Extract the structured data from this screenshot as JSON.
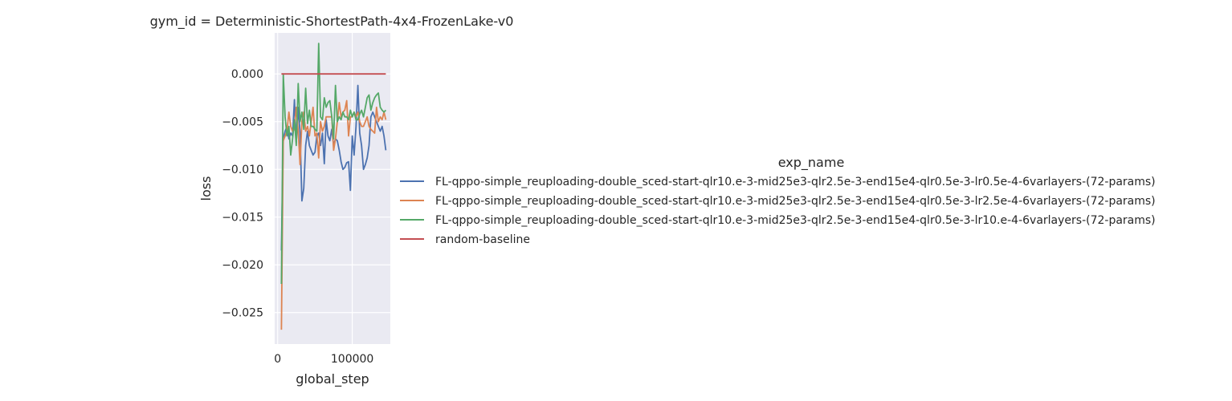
{
  "chart_data": {
    "type": "line",
    "title": "gym_id = Deterministic-ShortestPath-4x4-FrozenLake-v0",
    "xlabel": "global_step",
    "ylabel": "loss",
    "xlim": [
      -4000,
      151000
    ],
    "ylim": [
      -0.0283,
      0.0043
    ],
    "xticks": [
      0,
      100000
    ],
    "xtick_labels": [
      "0",
      "100000"
    ],
    "yticks": [
      0.0,
      -0.005,
      -0.01,
      -0.015,
      -0.02,
      -0.025
    ],
    "ytick_labels": [
      "0.000",
      "−0.005",
      "−0.010",
      "−0.015",
      "−0.020",
      "−0.025"
    ],
    "grid": true,
    "legend_position": "right",
    "legend_title": "exp_name",
    "series": [
      {
        "name": "FL-qppo-simple_reuploading-double_sced-start-qlr10.e-3-mid25e3-qlr2.5e-3-end15e4-qlr0.5e-3-lr0.5e-4-6varlayers-(72-params)",
        "color": "#4c72b0",
        "x": [
          5000,
          7500,
          10000,
          12500,
          15000,
          17500,
          20000,
          22500,
          25000,
          27500,
          30000,
          32500,
          35000,
          37500,
          40000,
          42500,
          45000,
          47500,
          50000,
          52500,
          55000,
          57500,
          60000,
          62500,
          65000,
          67500,
          70000,
          72500,
          75000,
          77500,
          80000,
          82500,
          85000,
          87500,
          90000,
          92500,
          95000,
          97500,
          100000,
          102500,
          105000,
          107500,
          110000,
          112500,
          115000,
          117500,
          120000,
          122500,
          125000,
          127500,
          130000,
          132500,
          135000,
          137500,
          140000,
          142500,
          145000
        ],
        "y": [
          -0.0185,
          -0.0068,
          -0.006,
          -0.0055,
          -0.0068,
          -0.0062,
          -0.0065,
          -0.0027,
          -0.0072,
          -0.0035,
          -0.0062,
          -0.0133,
          -0.012,
          -0.0075,
          -0.006,
          -0.0075,
          -0.008,
          -0.0085,
          -0.0082,
          -0.0065,
          -0.0062,
          -0.0075,
          -0.0062,
          -0.0094,
          -0.0048,
          -0.0065,
          -0.007,
          -0.0058,
          -0.0075,
          -0.0068,
          -0.007,
          -0.008,
          -0.0092,
          -0.01,
          -0.0098,
          -0.0093,
          -0.0092,
          -0.0122,
          -0.0065,
          -0.0085,
          -0.0055,
          -0.0012,
          -0.0062,
          -0.0075,
          -0.01,
          -0.0095,
          -0.0088,
          -0.0075,
          -0.0045,
          -0.004,
          -0.0045,
          -0.005,
          -0.0055,
          -0.006,
          -0.0055,
          -0.0065,
          -0.008
        ]
      },
      {
        "name": "FL-qppo-simple_reuploading-double_sced-start-qlr10.e-3-mid25e3-qlr2.5e-3-end15e4-qlr0.5e-3-lr2.5e-4-6varlayers-(72-params)",
        "color": "#dd8452",
        "x": [
          5000,
          7500,
          10000,
          12500,
          15000,
          17500,
          20000,
          22500,
          25000,
          27500,
          30000,
          32500,
          35000,
          37500,
          40000,
          42500,
          45000,
          47500,
          50000,
          52500,
          55000,
          57500,
          60000,
          62500,
          65000,
          67500,
          70000,
          72500,
          75000,
          77500,
          80000,
          82500,
          85000,
          87500,
          90000,
          92500,
          95000,
          97500,
          100000,
          102500,
          105000,
          107500,
          110000,
          112500,
          115000,
          117500,
          120000,
          122500,
          125000,
          127500,
          130000,
          132500,
          135000,
          137500,
          140000,
          142500,
          145000
        ],
        "y": [
          -0.0268,
          -0.007,
          -0.0065,
          -0.006,
          -0.004,
          -0.0055,
          -0.006,
          -0.0058,
          -0.0035,
          -0.006,
          -0.0095,
          -0.005,
          -0.004,
          -0.006,
          -0.0055,
          -0.0065,
          -0.005,
          -0.0035,
          -0.0065,
          -0.0062,
          -0.0088,
          -0.005,
          -0.006,
          -0.0055,
          -0.0045,
          -0.0045,
          -0.0045,
          -0.0045,
          -0.008,
          -0.0068,
          -0.005,
          -0.003,
          -0.0045,
          -0.004,
          -0.0038,
          -0.0028,
          -0.0065,
          -0.0045,
          -0.0045,
          -0.004,
          -0.0045,
          -0.004,
          -0.005,
          -0.0055,
          -0.0055,
          -0.005,
          -0.0045,
          -0.0055,
          -0.0058,
          -0.006,
          -0.0062,
          -0.0035,
          -0.005,
          -0.0045,
          -0.0048,
          -0.004,
          -0.0048
        ]
      },
      {
        "name": "FL-qppo-simple_reuploading-double_sced-start-qlr10.e-3-mid25e3-qlr2.5e-3-end15e4-qlr0.5e-3-lr10.e-4-6varlayers-(72-params)",
        "color": "#55a868",
        "x": [
          5000,
          7500,
          10000,
          12500,
          15000,
          17500,
          20000,
          22500,
          25000,
          27500,
          30000,
          32500,
          35000,
          37500,
          40000,
          42500,
          45000,
          47500,
          50000,
          52500,
          55000,
          57500,
          60000,
          62500,
          65000,
          67500,
          70000,
          72500,
          75000,
          77500,
          80000,
          82500,
          85000,
          87500,
          90000,
          92500,
          95000,
          97500,
          100000,
          102500,
          105000,
          107500,
          110000,
          112500,
          115000,
          117500,
          120000,
          122500,
          125000,
          127500,
          130000,
          132500,
          135000,
          137500,
          140000,
          142500,
          145000
        ],
        "y": [
          -0.022,
          0.0,
          -0.0045,
          -0.0065,
          -0.0055,
          -0.0085,
          -0.0068,
          -0.0048,
          -0.0075,
          -0.001,
          -0.005,
          -0.004,
          -0.0058,
          -0.0015,
          -0.0052,
          -0.0038,
          -0.0055,
          -0.0055,
          -0.0058,
          -0.006,
          0.0032,
          -0.0045,
          -0.0048,
          -0.0025,
          -0.0035,
          -0.003,
          -0.0028,
          -0.0045,
          -0.0068,
          -0.0012,
          -0.005,
          -0.0045,
          -0.0048,
          -0.004,
          -0.0045,
          -0.0045,
          -0.0048,
          -0.0038,
          -0.0045,
          -0.004,
          -0.0048,
          -0.0048,
          -0.0042,
          -0.0038,
          -0.0045,
          -0.0035,
          -0.0025,
          -0.0022,
          -0.0038,
          -0.003,
          -0.0025,
          -0.0022,
          -0.002,
          -0.0035,
          -0.0038,
          -0.004,
          -0.0038
        ]
      },
      {
        "name": "random-baseline",
        "color": "#c44e52",
        "x": [
          5000,
          145000
        ],
        "y": [
          0.0,
          0.0
        ]
      }
    ]
  }
}
